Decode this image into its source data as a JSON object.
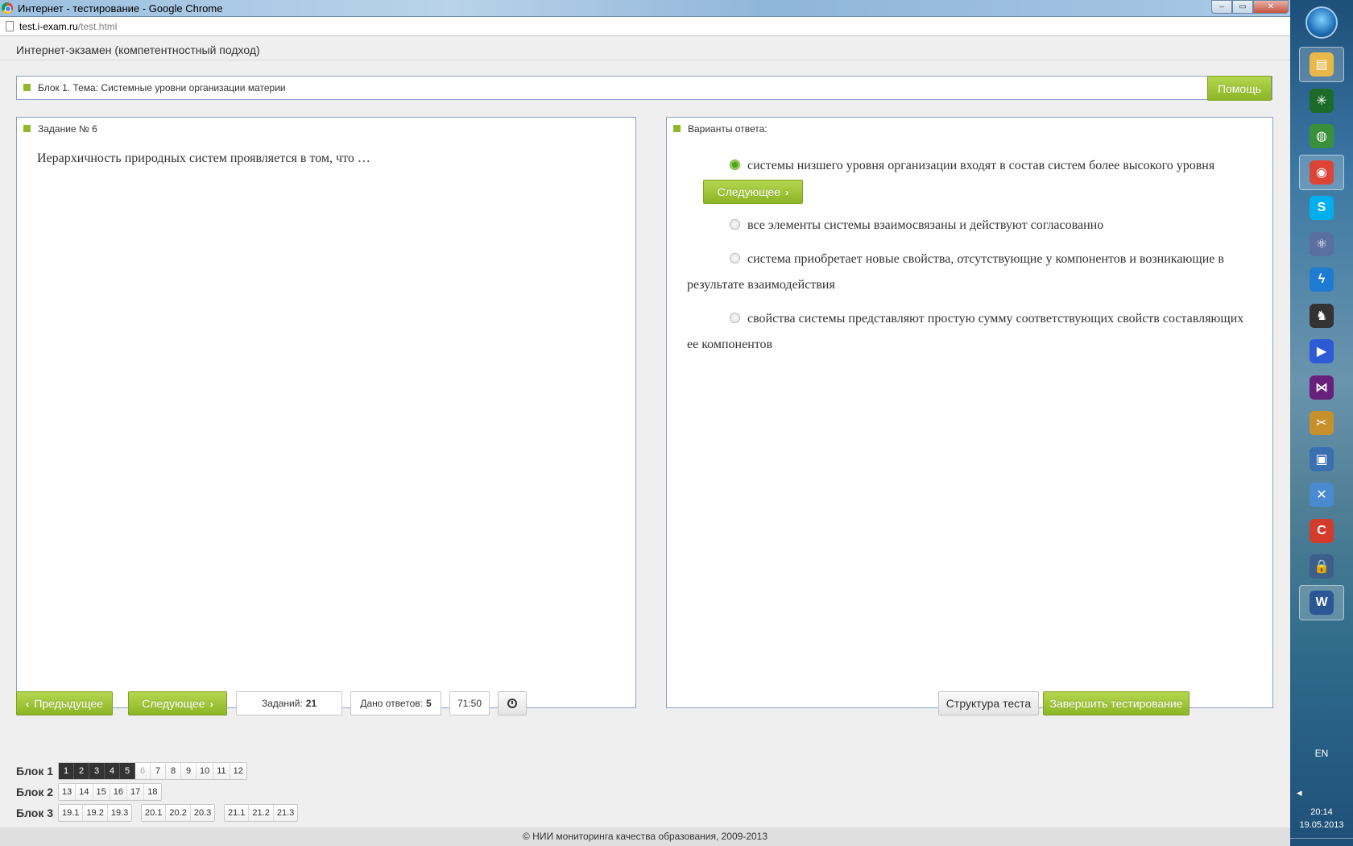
{
  "window": {
    "title": "Интернет - тестирование - Google Chrome",
    "controls": {
      "minimize": "‒",
      "maximize": "▭",
      "close": "✕"
    }
  },
  "address": {
    "host": "test.i-exam.ru",
    "path": "/test.html"
  },
  "page": {
    "exam_title": "Интернет-экзамен (компетентностный подход)",
    "topic": "Блок 1. Тема: Системные уровни организации материи",
    "help_label": "Помощь"
  },
  "task": {
    "caption": "Задание № 6",
    "question": "Иерархичность природных систем проявляется в том, что …"
  },
  "answers": {
    "caption": "Варианты ответа:",
    "options": [
      {
        "text": "системы низшего уровня организации входят в состав систем более высокого уровня",
        "selected": true
      },
      {
        "text": "все элементы системы взаимосвязаны и действуют согласованно",
        "selected": false
      },
      {
        "text": "система приобретает новые свойства, отсутствующие у компонентов и возникающие в результате взаимодействия",
        "selected": false
      },
      {
        "text": "свойства системы представляют простую сумму соответствующих свойств составляющих ее компонентов",
        "selected": false
      }
    ],
    "inline_next_label": "Следующее"
  },
  "controls": {
    "prev_label": "Предыдущее",
    "next_label": "Следующее",
    "tasks_label": "Заданий:",
    "tasks_count": "21",
    "answered_label": "Дано ответов:",
    "answered_count": "5",
    "timer": "71:50",
    "structure_label": "Структура теста",
    "finish_label": "Завершить тестирование"
  },
  "blocks": [
    {
      "label": "Блок 1",
      "groups": [
        [
          {
            "n": "1",
            "state": "answered"
          },
          {
            "n": "2",
            "state": "answered"
          },
          {
            "n": "3",
            "state": "answered"
          },
          {
            "n": "4",
            "state": "answered"
          },
          {
            "n": "5",
            "state": "answered"
          },
          {
            "n": "6",
            "state": "current"
          },
          {
            "n": "7",
            "state": ""
          },
          {
            "n": "8",
            "state": ""
          },
          {
            "n": "9",
            "state": ""
          },
          {
            "n": "10",
            "state": ""
          },
          {
            "n": "11",
            "state": ""
          },
          {
            "n": "12",
            "state": ""
          }
        ]
      ]
    },
    {
      "label": "Блок 2",
      "groups": [
        [
          {
            "n": "13",
            "state": ""
          },
          {
            "n": "14",
            "state": ""
          },
          {
            "n": "15",
            "state": ""
          },
          {
            "n": "16",
            "state": ""
          },
          {
            "n": "17",
            "state": ""
          },
          {
            "n": "18",
            "state": ""
          }
        ]
      ]
    },
    {
      "label": "Блок 3",
      "groups": [
        [
          {
            "n": "19.1",
            "state": ""
          },
          {
            "n": "19.2",
            "state": ""
          },
          {
            "n": "19.3",
            "state": ""
          }
        ],
        [
          {
            "n": "20.1",
            "state": ""
          },
          {
            "n": "20.2",
            "state": ""
          },
          {
            "n": "20.3",
            "state": ""
          }
        ],
        [
          {
            "n": "21.1",
            "state": ""
          },
          {
            "n": "21.2",
            "state": ""
          },
          {
            "n": "21.3",
            "state": ""
          }
        ]
      ]
    }
  ],
  "footer": "© НИИ мониторинга качества образования, 2009-2013",
  "taskbar": {
    "apps": [
      {
        "icon": "folder-icon",
        "color": "#e8b84a",
        "glyph": "▤",
        "active": true
      },
      {
        "icon": "monitor-app-icon",
        "color": "#1d6b2a",
        "glyph": "✳",
        "active": false
      },
      {
        "icon": "network-globe-icon",
        "color": "#3a8f3a",
        "glyph": "◍",
        "active": false
      },
      {
        "icon": "chrome-icon",
        "color": "#db4437",
        "glyph": "◉",
        "active": true
      },
      {
        "icon": "skype-icon",
        "color": "#00aff0",
        "glyph": "S",
        "active": false
      },
      {
        "icon": "atom-app-icon",
        "color": "#5a6fa0",
        "glyph": "⚛",
        "active": false
      },
      {
        "icon": "lightning-app-icon",
        "color": "#1f7ad1",
        "glyph": "ϟ",
        "active": false
      },
      {
        "icon": "fox-app-icon",
        "color": "#333333",
        "glyph": "♞",
        "active": false
      },
      {
        "icon": "player-app-icon",
        "color": "#2d5bd6",
        "glyph": "▶",
        "active": false
      },
      {
        "icon": "visual-studio-icon",
        "color": "#68217a",
        "glyph": "⋈",
        "active": false
      },
      {
        "icon": "tools-app-icon",
        "color": "#c8902a",
        "glyph": "✂",
        "active": false
      },
      {
        "icon": "remote-desktop-icon",
        "color": "#3a6fb0",
        "glyph": "▣",
        "active": false
      },
      {
        "icon": "shield-tools-icon",
        "color": "#4a8ad0",
        "glyph": "✕",
        "active": false
      },
      {
        "icon": "ccleaner-icon",
        "color": "#d33c2c",
        "glyph": "C",
        "active": false
      },
      {
        "icon": "lock-app-icon",
        "color": "#3c5f8a",
        "glyph": "🔒",
        "active": false
      },
      {
        "icon": "word-icon",
        "color": "#2b5797",
        "glyph": "W",
        "active": true
      }
    ],
    "lang": "EN",
    "time": "20:14",
    "date": "19.05.2013"
  }
}
